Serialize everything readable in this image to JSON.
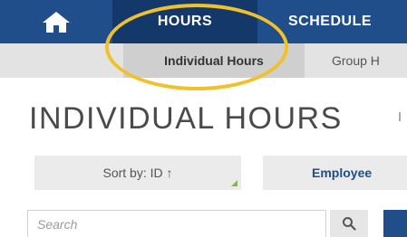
{
  "nav": {
    "home_icon": "home-icon",
    "hours_label": "HOURS",
    "schedule_label": "SCHEDULE"
  },
  "subnav": {
    "individual_label": "Individual Hours",
    "group_label": "Group H"
  },
  "page": {
    "title": "INDIVIDUAL HOURS"
  },
  "toolbar": {
    "sort_label": "Sort by: ID ↑",
    "employee_label": "Employee"
  },
  "search": {
    "placeholder": "Search",
    "icon": "search-icon"
  },
  "colors": {
    "nav_bg": "#1f4e8a",
    "nav_active_bg": "#14386a",
    "highlight": "#f0c12a",
    "sort_accent": "#7bbf3a"
  }
}
